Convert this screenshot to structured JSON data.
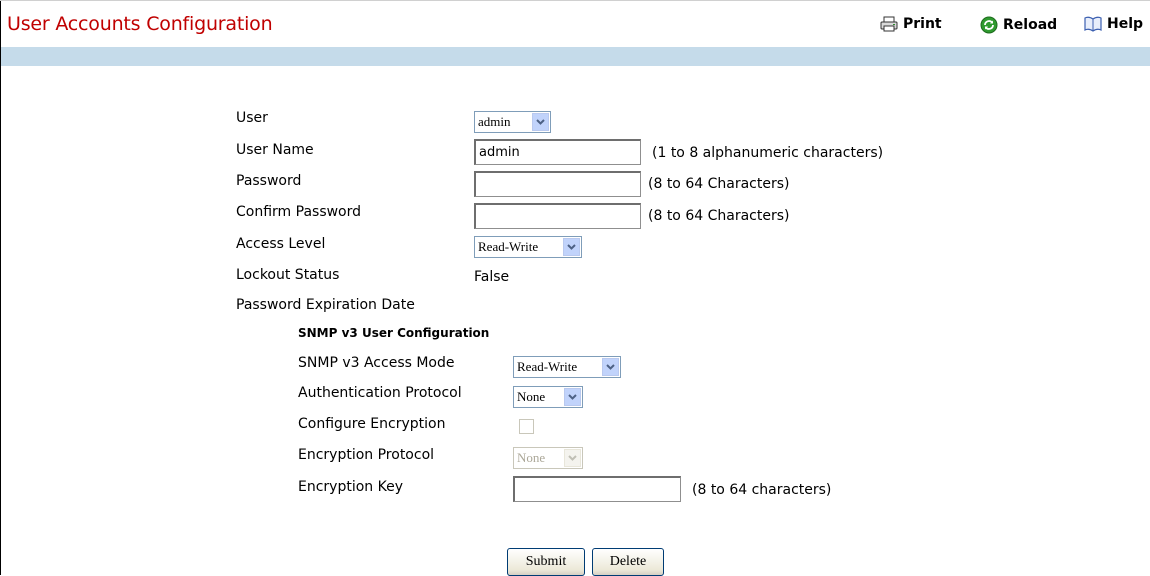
{
  "header": {
    "title": "User Accounts Configuration",
    "print_label": "Print",
    "reload_label": "Reload",
    "help_label": "Help"
  },
  "form": {
    "user": {
      "label": "User",
      "selected": "admin"
    },
    "user_name": {
      "label": "User Name",
      "value": "admin",
      "hint": "(1 to 8 alphanumeric characters)"
    },
    "password": {
      "label": "Password",
      "value": "",
      "hint": "(8 to 64 Characters)"
    },
    "confirm_password": {
      "label": "Confirm Password",
      "value": "",
      "hint": "(8 to 64 Characters)"
    },
    "access_level": {
      "label": "Access Level",
      "selected": "Read-Write"
    },
    "lockout_status": {
      "label": "Lockout Status",
      "value": "False"
    },
    "password_expiration": {
      "label": "Password Expiration Date",
      "value": ""
    }
  },
  "snmp": {
    "section_title": "SNMP v3 User Configuration",
    "access_mode": {
      "label": "SNMP v3 Access Mode",
      "selected": "Read-Write"
    },
    "auth_protocol": {
      "label": "Authentication Protocol",
      "selected": "None"
    },
    "configure_encryption": {
      "label": "Configure Encryption",
      "checked": false
    },
    "encryption_protocol": {
      "label": "Encryption Protocol",
      "selected": "None"
    },
    "encryption_key": {
      "label": "Encryption Key",
      "value": "",
      "hint": "(8 to 64 characters)"
    }
  },
  "buttons": {
    "submit": "Submit",
    "delete": "Delete"
  },
  "colors": {
    "title": "#c00000",
    "band": "#c5dbea"
  }
}
